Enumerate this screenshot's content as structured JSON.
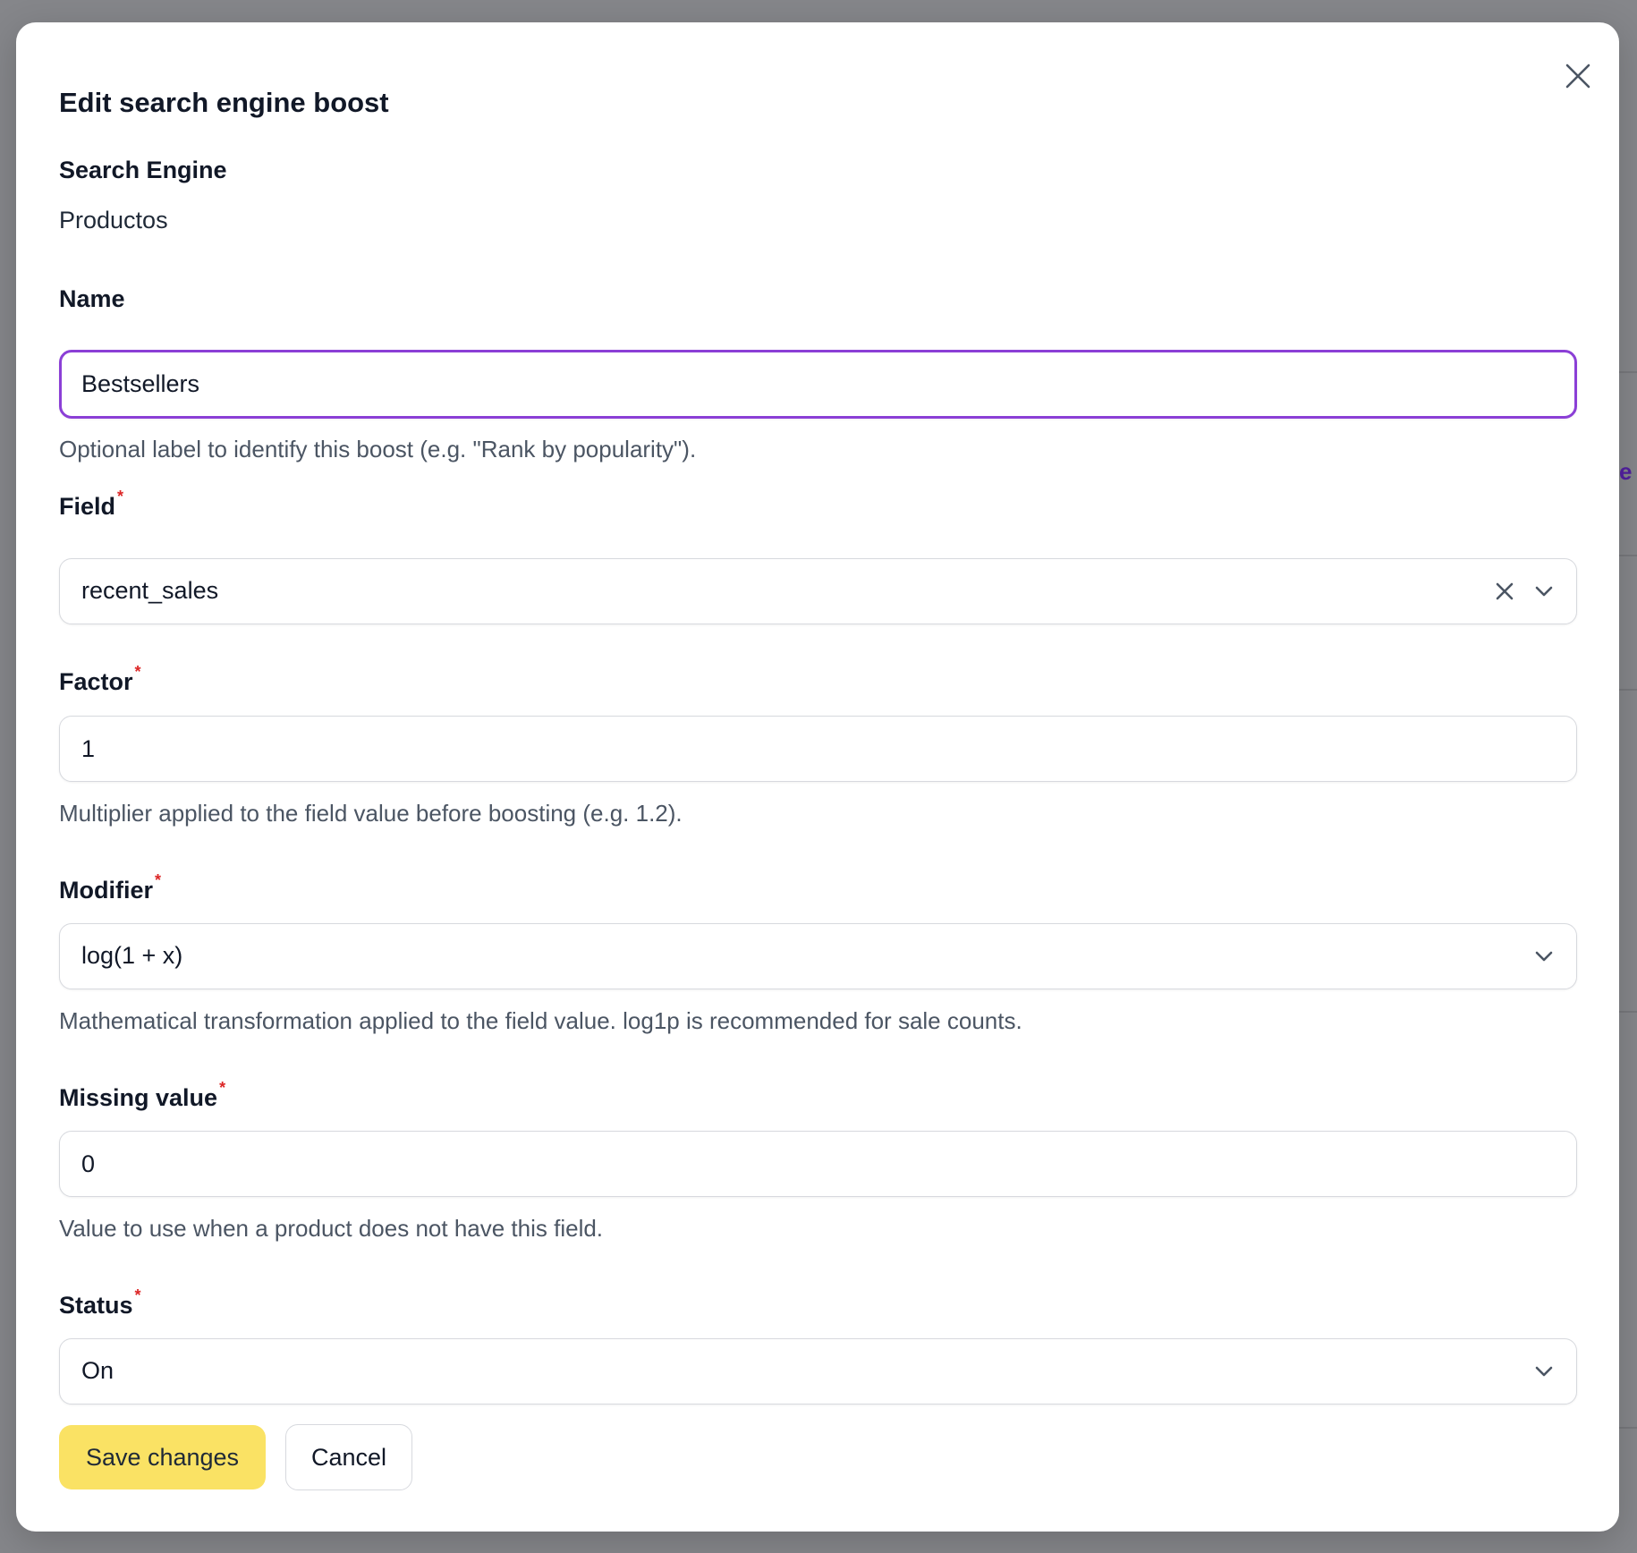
{
  "modal": {
    "title": "Edit search engine boost"
  },
  "search_engine": {
    "label": "Search Engine",
    "value": "Productos"
  },
  "name": {
    "label": "Name",
    "value": "Bestsellers",
    "help": "Optional label to identify this boost (e.g. \"Rank by popularity\")."
  },
  "field": {
    "label": "Field",
    "required_mark": "*",
    "value": "recent_sales"
  },
  "factor": {
    "label": "Factor",
    "required_mark": "*",
    "value": "1",
    "help": "Multiplier applied to the field value before boosting (e.g. 1.2)."
  },
  "modifier": {
    "label": "Modifier",
    "required_mark": "*",
    "value": "log(1 + x)",
    "help": "Mathematical transformation applied to the field value. log1p is recommended for sale counts."
  },
  "missing_value": {
    "label": "Missing value",
    "required_mark": "*",
    "value": "0",
    "help": "Value to use when a product does not have this field."
  },
  "status": {
    "label": "Status",
    "required_mark": "*",
    "value": "On"
  },
  "buttons": {
    "save_label": "Save changes",
    "cancel_label": "Cancel"
  },
  "colors": {
    "focus_ring": "#8b3fd6",
    "primary_button": "#fae264",
    "required_mark": "#dc2626",
    "backdrop": "#85868a"
  },
  "icons": {
    "close": "close-icon",
    "clear": "clear-icon",
    "dropdown": "chevron-down-icon"
  }
}
